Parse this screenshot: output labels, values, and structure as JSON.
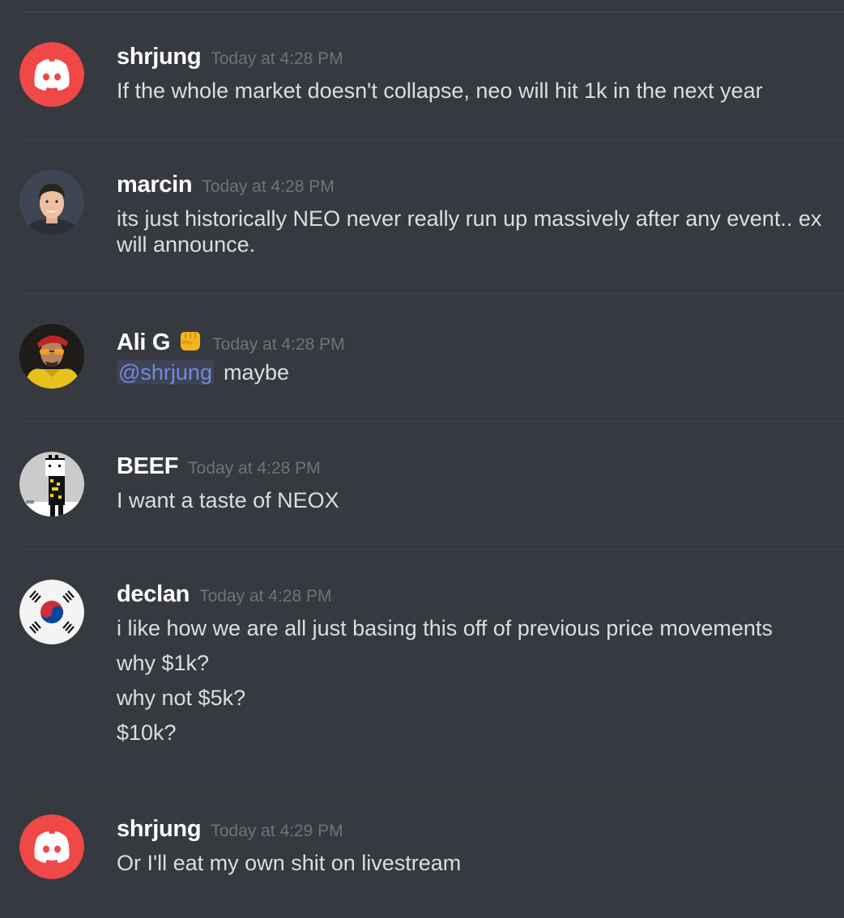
{
  "messages": [
    {
      "author": "shrjung",
      "timestamp": "Today at 4:28 PM",
      "avatar": "discord-logo-icon",
      "lines": [
        "If the whole market doesn't collapse, neo will hit 1k in the next year"
      ]
    },
    {
      "author": "marcin",
      "timestamp": "Today at 4:28 PM",
      "avatar": "user-photo",
      "lines": [
        "its just historically NEO never really run up massively after any event.. ex",
        "will announce."
      ]
    },
    {
      "author": "Ali G",
      "author_emoji": "fist-emoji-icon",
      "timestamp": "Today at 4:28 PM",
      "avatar": "user-photo",
      "mention": "@shrjung",
      "text": "maybe"
    },
    {
      "author": "BEEF",
      "timestamp": "Today at 4:28 PM",
      "avatar": "pixel-art-avatar",
      "lines": [
        "I want a taste of NEOX"
      ]
    },
    {
      "author": "declan",
      "timestamp": "Today at 4:28 PM",
      "avatar": "korean-flag-icon",
      "lines": [
        "i like how we are all just basing this off of previous price movements",
        "why $1k?",
        "why not $5k?",
        "$10k?"
      ]
    },
    {
      "author": "shrjung",
      "timestamp": "Today at 4:29 PM",
      "avatar": "discord-logo-icon",
      "lines": [
        "Or I'll eat my own shit on livestream"
      ]
    }
  ],
  "colors": {
    "background": "#36393f",
    "username": "#ffffff",
    "timestamp": "#72767d",
    "text": "#dcddde",
    "mention": "#7289da",
    "discord_red": "#f04747"
  }
}
